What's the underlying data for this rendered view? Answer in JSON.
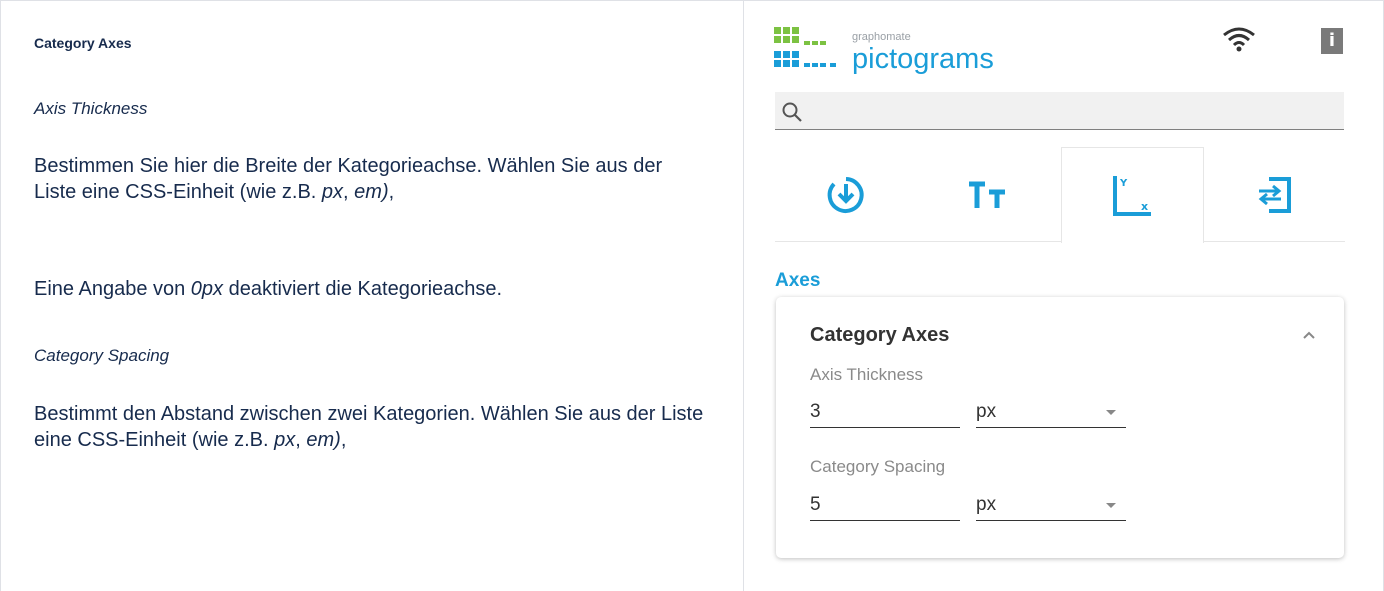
{
  "doc": {
    "heading": "Category Axes",
    "axis_thickness": {
      "subtitle": "Axis Thickness",
      "para1_a": "Bestimmen Sie hier die Breite der Kategorieachse. Wählen Sie aus der Liste eine CSS-Einheit (wie z.B. ",
      "para1_px": "px",
      "para1_sep": ", ",
      "para1_em": "em)",
      "para1_end": ",",
      "para2_a": "Eine Angabe von ",
      "para2_0px": "0px",
      "para2_b": " deaktiviert die Kategorieachse."
    },
    "category_spacing": {
      "subtitle": "Category Spacing",
      "para_a": "Bestimmt den Abstand zwischen zwei Kategorien. Wählen Sie aus der Liste eine CSS-Einheit (wie z.B. ",
      "para_px": "px",
      "para_sep": ", ",
      "para_em": "em)",
      "para_end": ","
    }
  },
  "app": {
    "logo": {
      "small": "graphomate",
      "big": "pictograms"
    },
    "search": {
      "placeholder": ""
    },
    "tabs": [
      {
        "icon": "data-icon",
        "active": false
      },
      {
        "icon": "text-format-icon",
        "active": false
      },
      {
        "icon": "axes-icon",
        "active": true
      },
      {
        "icon": "layout-icon",
        "active": false
      }
    ],
    "section_title": "Axes",
    "card": {
      "title": "Category Axes",
      "axis_thickness_label": "Axis Thickness",
      "axis_thickness_value": "3",
      "axis_thickness_unit": "px",
      "category_spacing_label": "Category Spacing",
      "category_spacing_value": "5",
      "category_spacing_unit": "px"
    },
    "colors": {
      "accent": "#1a9dd8",
      "info_bg": "#7a7a7a"
    }
  }
}
